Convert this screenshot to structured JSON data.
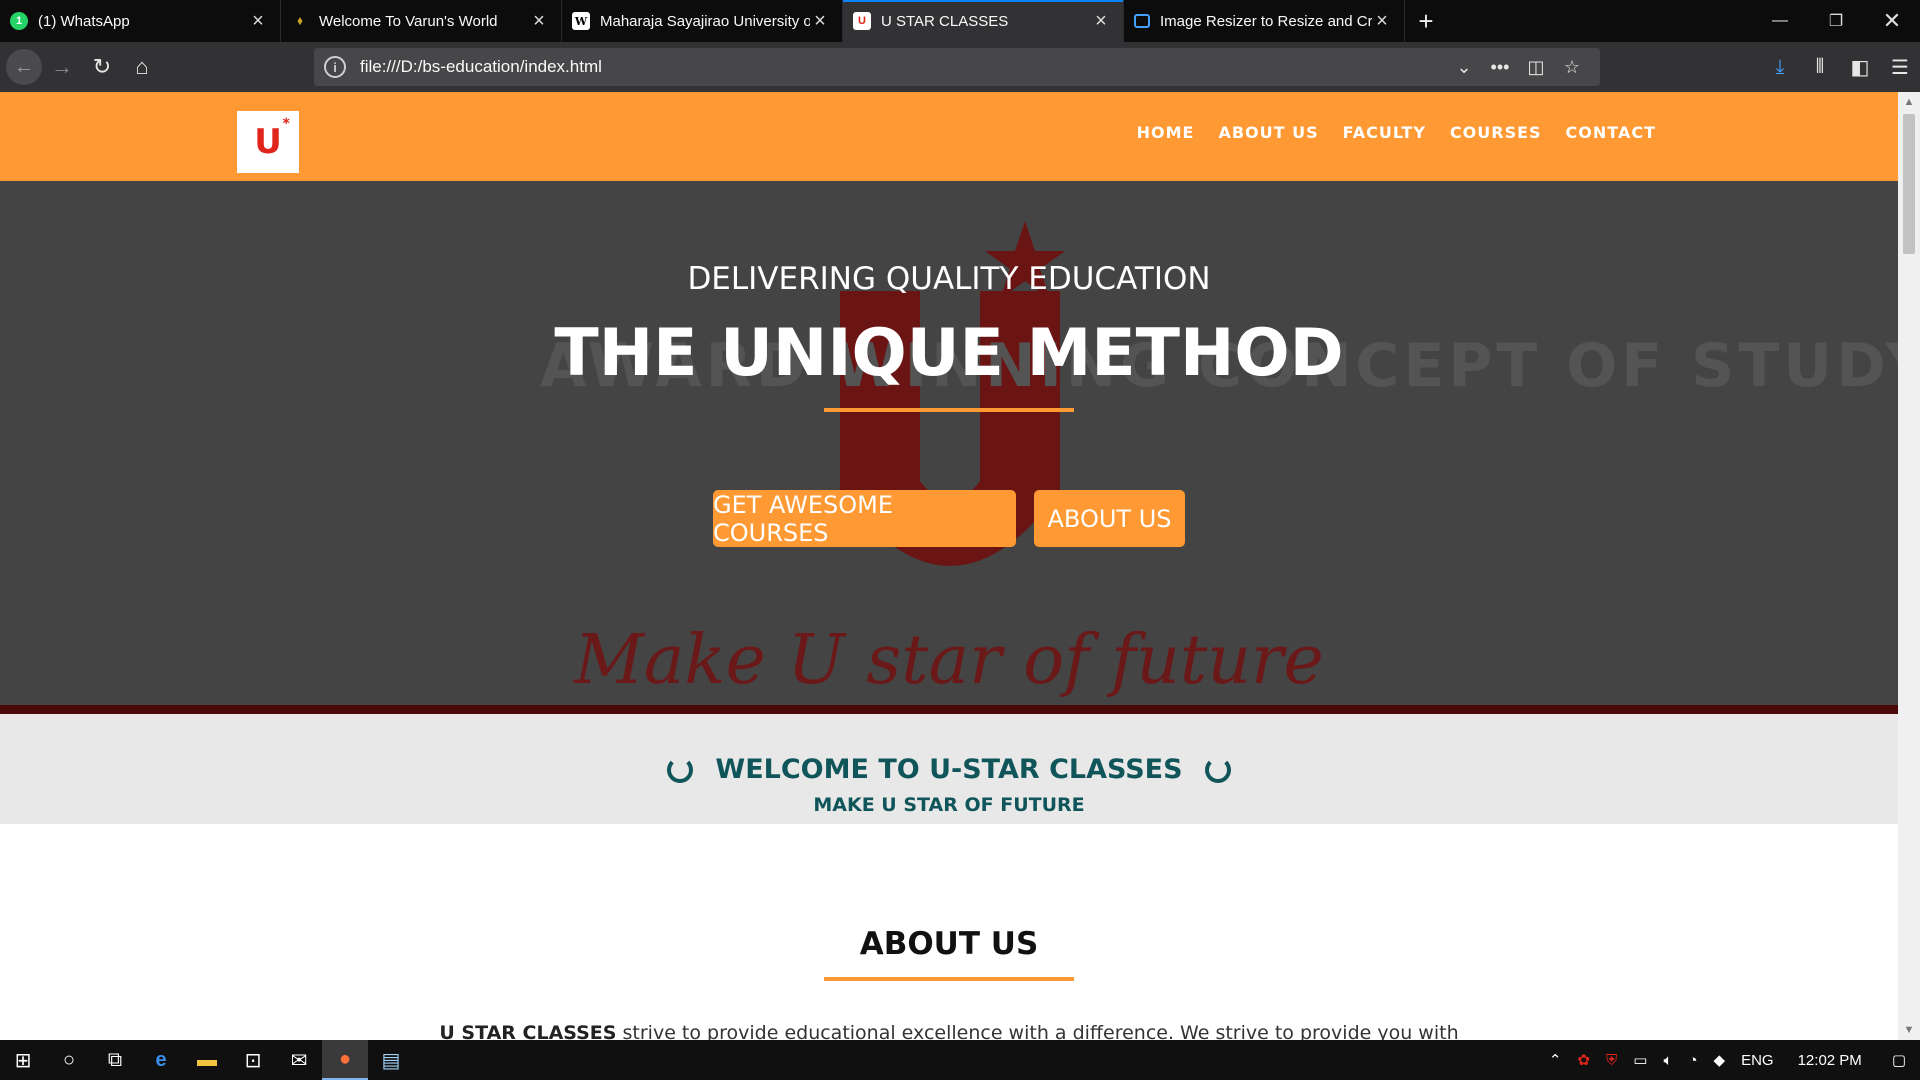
{
  "browser": {
    "tabs": [
      {
        "title": "(1) WhatsApp",
        "icon": "whatsapp-icon",
        "color": "#25d366",
        "active": false
      },
      {
        "title": "Welcome To Varun's World",
        "icon": "varun-icon",
        "color": "#222222",
        "active": false
      },
      {
        "title": "Maharaja Sayajirao University o",
        "icon": "wikipedia-icon",
        "color": "#ffffff",
        "active": false
      },
      {
        "title": "U STAR CLASSES",
        "icon": "ustar-icon",
        "color": "#e1251b",
        "active": true
      },
      {
        "title": "Image Resizer to Resize and Cr",
        "icon": "resizer-icon",
        "color": "#45a1ff",
        "active": false
      }
    ],
    "url": "file:///D:/bs-education/index.html"
  },
  "site": {
    "logo_text": "U",
    "menu": [
      "HOME",
      "ABOUT US",
      "FACULTY",
      "COURSES",
      "CONTACT"
    ],
    "hero": {
      "bg_text": "AWARD WINNING CONCEPT OF STUDY MODEL",
      "script": "Make U star of future",
      "subtitle": "DELIVERING QUALITY EDUCATION",
      "title": "THE UNIQUE METHOD",
      "btn_courses": "GET AWESOME COURSES",
      "btn_about": "ABOUT US"
    },
    "welcome": {
      "title": "WELCOME TO U-STAR CLASSES",
      "subtitle": "MAKE U STAR OF FUTURE"
    },
    "about": {
      "title": "ABOUT US",
      "text_bold": "U STAR CLASSES",
      "text": " strive to provide educational excellence with a difference. We strive to provide you with"
    },
    "colors": {
      "accent": "#fe9933",
      "teal": "#10555a",
      "hero_bg": "#444444"
    }
  },
  "taskbar": {
    "lang": "ENG",
    "time": "12:02 PM"
  }
}
